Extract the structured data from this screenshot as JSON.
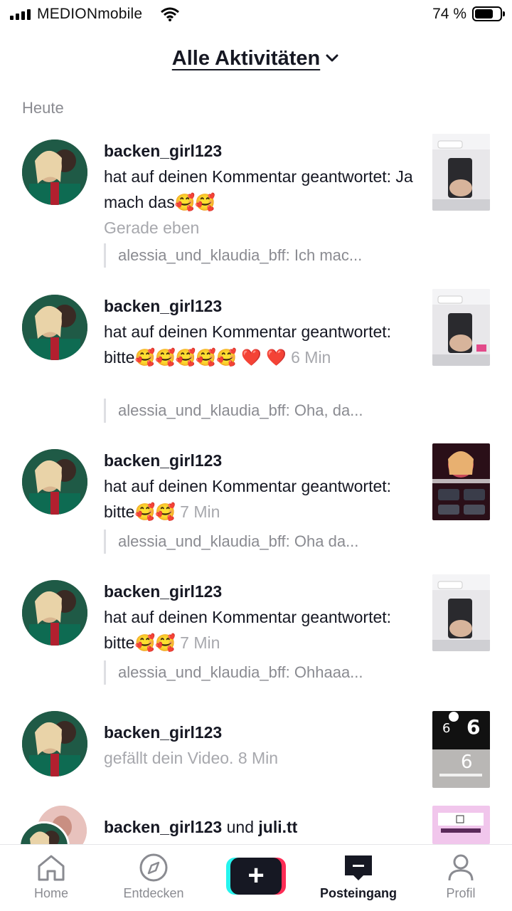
{
  "status_bar": {
    "carrier": "MEDIONmobile",
    "battery": "74 %",
    "battery_level": 0.74
  },
  "header": {
    "title": "Alle Aktivitäten"
  },
  "section_label": "Heute",
  "activities": [
    {
      "user": "backen_girl123",
      "text": "hat auf deinen Kommentar geantwortet: Ja mach das🥰🥰",
      "time": "Gerade eben",
      "quote": "alessia_und_klaudia_bff: Ich mac..."
    },
    {
      "user": "backen_girl123",
      "text": "hat auf deinen Kommentar geantwortet: bitte🥰🥰🥰🥰🥰 ❤️ ❤️",
      "time": "6 Min",
      "quote": "alessia_und_klaudia_bff: Oha, da..."
    },
    {
      "user": "backen_girl123",
      "text": "hat auf deinen Kommentar geantwortet: bitte🥰🥰",
      "time": "7 Min",
      "quote": "alessia_und_klaudia_bff: Oha da..."
    },
    {
      "user": "backen_girl123",
      "text": "hat auf deinen Kommentar geantwortet: bitte🥰🥰",
      "time": "7 Min",
      "quote": "alessia_und_klaudia_bff: Ohhaaa..."
    },
    {
      "user": "backen_girl123",
      "text": "gefällt dein Video.",
      "time": "8 Min"
    },
    {
      "user": "backen_girl123",
      "connector": "und",
      "user2": "juli.tt"
    }
  ],
  "bottom_nav": {
    "home": "Home",
    "discover": "Entdecken",
    "create": "+",
    "inbox": "Posteingang",
    "profile": "Profil"
  },
  "colors": {
    "text": "#161823",
    "secondary": "#8a8b91",
    "accent_cyan": "#25f4ee",
    "accent_red": "#fe2c55"
  }
}
